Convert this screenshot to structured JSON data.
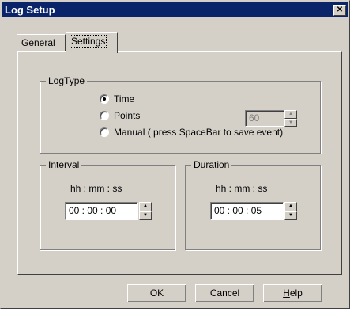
{
  "window": {
    "title": "Log Setup",
    "close_glyph": "✕"
  },
  "tabs": [
    {
      "label": "General"
    },
    {
      "label": "Settings",
      "active": true
    }
  ],
  "logtype": {
    "group_label": "LogType",
    "options": [
      {
        "label": "Time",
        "selected": true
      },
      {
        "label": "Points",
        "selected": false
      },
      {
        "label": "Manual ( press SpaceBar to save event)",
        "selected": false
      }
    ],
    "points_value": "60"
  },
  "interval": {
    "group_label": "Interval",
    "format": "hh : mm : ss",
    "value": "00 : 00 : 00"
  },
  "duration": {
    "group_label": "Duration",
    "format": "hh : mm : ss",
    "value": "00 : 00 : 05"
  },
  "buttons": {
    "ok": "OK",
    "cancel": "Cancel",
    "help_first": "H",
    "help_rest": "elp"
  },
  "icons": {
    "spin_up": "▲",
    "spin_down": "▼"
  }
}
